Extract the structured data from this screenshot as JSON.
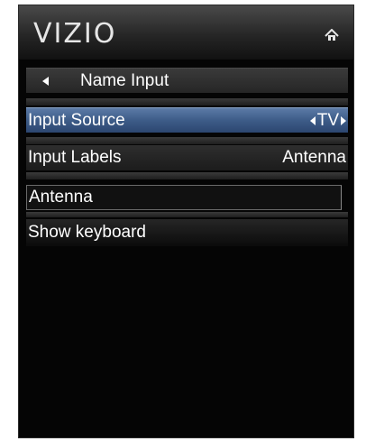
{
  "header": {
    "logo_text": "VIZIO",
    "home_icon": "home-icon"
  },
  "menu": {
    "back": {
      "label": "Name Input",
      "icon": "back-arrow-icon"
    },
    "rows": [
      {
        "label": "Input Source",
        "value": "TV",
        "selected": true,
        "has_arrows": true
      },
      {
        "label": "Input Labels",
        "value": "Antenna",
        "selected": false,
        "has_arrows": false
      }
    ],
    "name_field": {
      "value": "Antenna"
    },
    "show_keyboard_label": "Show keyboard"
  },
  "colors": {
    "background": "#050505",
    "selected_row": "#3d5c88",
    "text": "#ffffff"
  }
}
